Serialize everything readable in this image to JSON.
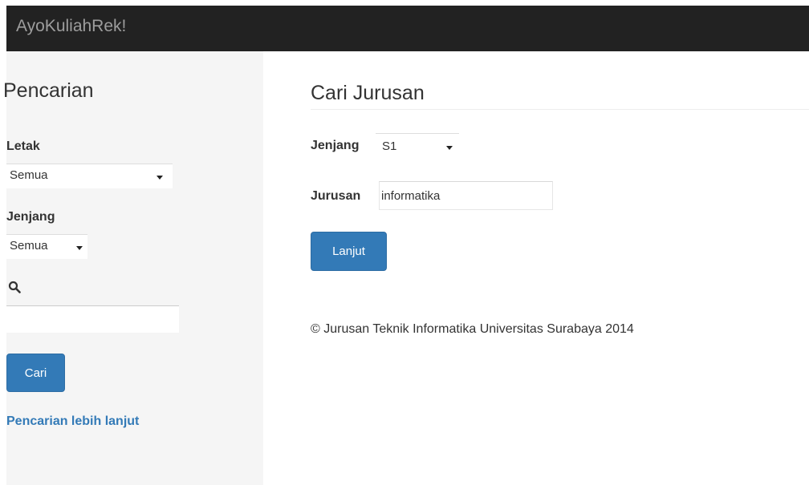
{
  "navbar": {
    "brand": "AyoKuliahRek!"
  },
  "sidebar": {
    "heading": "Pencarian",
    "letak": {
      "label": "Letak",
      "selected": "Semua"
    },
    "jenjang": {
      "label": "Jenjang",
      "selected": "Semua"
    },
    "search": {
      "icon": "search-icon",
      "value": "",
      "placeholder": ""
    },
    "button_label": "Cari",
    "advanced_link": "Pencarian lebih lanjut"
  },
  "main": {
    "title": "Cari Jurusan",
    "jenjang": {
      "label": "Jenjang",
      "selected": "S1"
    },
    "jurusan": {
      "label": "Jurusan",
      "value": "informatika"
    },
    "button_label": "Lanjut",
    "footer": "© Jurusan Teknik Informatika Universitas Surabaya 2014"
  },
  "colors": {
    "navbar_bg": "#222222",
    "brand_text": "#9d9d9d",
    "sidebar_bg": "#f5f5f5",
    "primary": "#337ab7",
    "link": "#337ab7"
  }
}
